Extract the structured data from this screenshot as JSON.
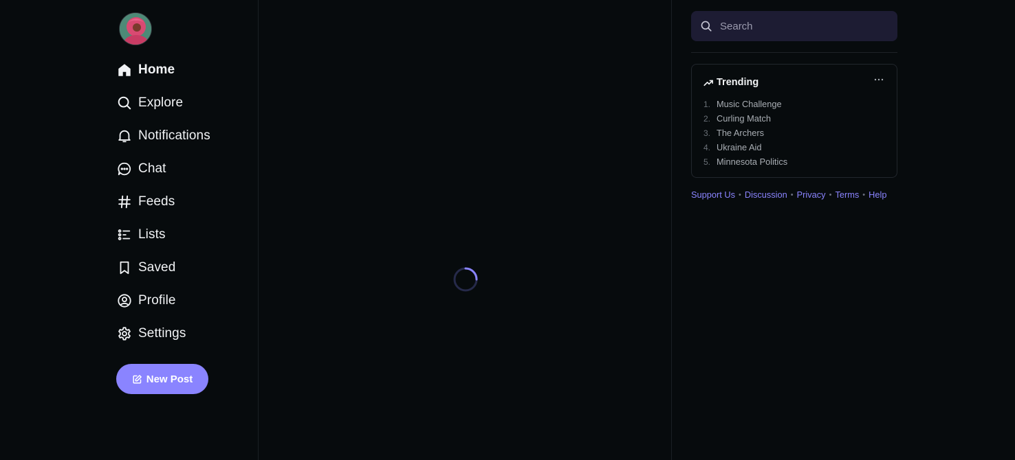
{
  "nav": {
    "avatar_icon": "user-avatar",
    "items": [
      {
        "label": "Home",
        "icon": "home-icon",
        "active": true
      },
      {
        "label": "Explore",
        "icon": "search-icon"
      },
      {
        "label": "Notifications",
        "icon": "bell-icon"
      },
      {
        "label": "Chat",
        "icon": "chat-icon"
      },
      {
        "label": "Feeds",
        "icon": "hashtag-icon"
      },
      {
        "label": "Lists",
        "icon": "list-icon"
      },
      {
        "label": "Saved",
        "icon": "bookmark-icon"
      },
      {
        "label": "Profile",
        "icon": "user-circle-icon"
      },
      {
        "label": "Settings",
        "icon": "gear-icon"
      }
    ],
    "new_post_label": "New Post",
    "new_post_icon": "edit-icon"
  },
  "main": {
    "loading_icon": "spinner-icon"
  },
  "search": {
    "placeholder": "Search",
    "value": ""
  },
  "trending": {
    "title": "Trending",
    "items": [
      {
        "num": "1.",
        "label": "Music Challenge"
      },
      {
        "num": "2.",
        "label": "Curling Match"
      },
      {
        "num": "3.",
        "label": "The Archers"
      },
      {
        "num": "4.",
        "label": "Ukraine Aid"
      },
      {
        "num": "5.",
        "label": "Minnesota Politics"
      }
    ]
  },
  "footer": {
    "links": [
      "Support Us",
      "Discussion",
      "Privacy",
      "Terms",
      "Help"
    ],
    "separator": "•"
  },
  "colors": {
    "background": "#070b0d",
    "accent": "#8a84ff",
    "search_bg": "#1d1c33",
    "text": "#f1f3f5",
    "muted": "#a9aeb4"
  }
}
